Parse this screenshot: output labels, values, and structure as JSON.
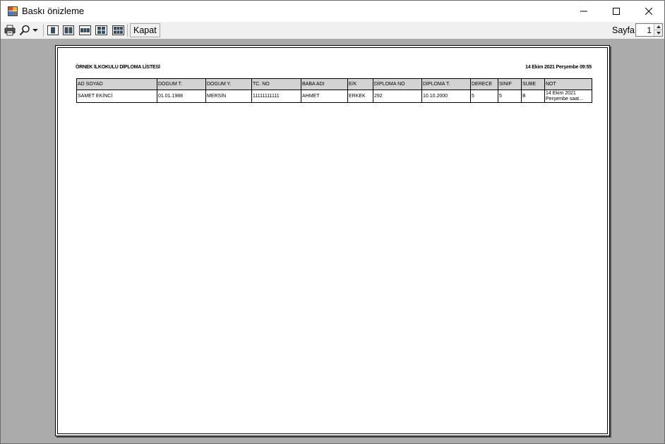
{
  "window": {
    "title": "Baskı önizleme"
  },
  "toolbar": {
    "print_icon": "printer-icon",
    "zoom_icon": "magnifier-icon",
    "close_label": "Kapat",
    "page_label": "Sayfa",
    "page_value": "1"
  },
  "report": {
    "title": "ÖRNEK İLKOKULU DİPLOMA LİSTESİ",
    "date": "14 Ekim 2021 Perşembe 09:55",
    "columns": [
      "AD SOYAD",
      "DOGUM T.",
      "DOGUM Y.",
      "TC. NO",
      "BABA ADI",
      "E/K",
      "DİPLOMA NO",
      "DİPLOMA T.",
      "DERECE",
      "SINIF",
      "SUBE",
      "NOT"
    ],
    "rows": [
      [
        "SAMET EKİNCİ",
        "01.01.1988",
        "MERSİN",
        "11111111111",
        "AHMET",
        "ERKEK",
        "292",
        "10.10.2000",
        "5",
        "5",
        "B",
        "14 Ekim 2021 Perşembe saat..."
      ]
    ]
  },
  "colors": {
    "preview_bg": "#ababab",
    "header_bg": "#d3d3d3",
    "toolbar_bg": "#f0f0f0"
  }
}
